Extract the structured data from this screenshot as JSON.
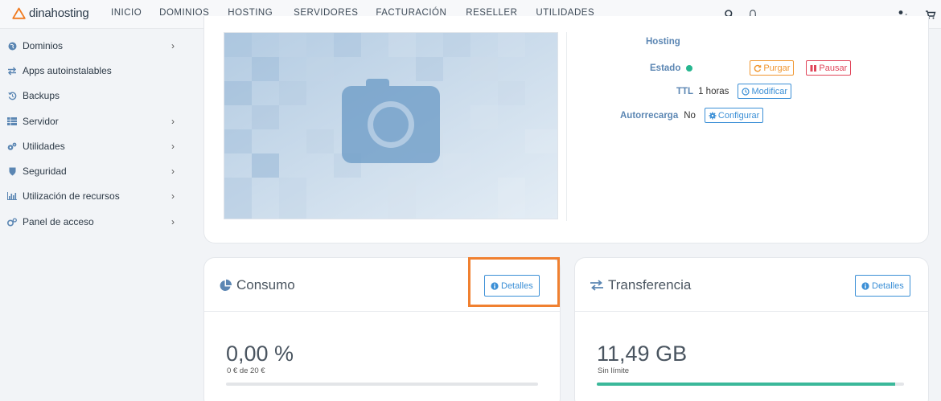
{
  "header": {
    "logo_text": "dinahosting",
    "nav": [
      "INICIO",
      "DOMINIOS",
      "HOSTING",
      "SERVIDORES",
      "FACTURACIÓN",
      "RESELLER",
      "UTILIDADES"
    ],
    "icons": [
      "search-icon",
      "bell-icon",
      "user-icon",
      "cart-icon"
    ]
  },
  "sidebar": {
    "items": [
      {
        "label": "Dominios",
        "icon": "globe-icon",
        "chevron": true
      },
      {
        "label": "Apps autoinstalables",
        "icon": "exchange-icon",
        "chevron": false
      },
      {
        "label": "Backups",
        "icon": "history-icon",
        "chevron": false
      },
      {
        "label": "Servidor",
        "icon": "server-icon",
        "chevron": true
      },
      {
        "label": "Utilidades",
        "icon": "cogs-icon",
        "chevron": true
      },
      {
        "label": "Seguridad",
        "icon": "shield-icon",
        "chevron": true
      },
      {
        "label": "Utilización de recursos",
        "icon": "bar-chart-icon",
        "chevron": true
      },
      {
        "label": "Panel de acceso",
        "icon": "gears-icon",
        "chevron": true
      }
    ],
    "chevron_glyph": "›"
  },
  "details": {
    "hosting_label": "Hosting",
    "estado_label": "Estado",
    "purgar_label": "Purgar",
    "pausar_label": "Pausar",
    "ttl_label": "TTL",
    "ttl_value": "1 horas",
    "modificar_label": "Modificar",
    "autorrecarga_label": "Autorrecarga",
    "autorrecarga_value": "No",
    "configurar_label": "Configurar",
    "status_color": "#26b68f"
  },
  "consumo": {
    "title": "Consumo",
    "detalles_label": "Detalles",
    "value": "0,00 %",
    "sub": "0 € de 20 €",
    "progress": 0
  },
  "transferencia": {
    "title": "Transferencia",
    "detalles_label": "Detalles",
    "value": "11,49 GB",
    "sub": "Sin límite",
    "progress": 0.97
  },
  "colors": {
    "accent_blue": "#3b8fd6",
    "highlight_orange": "#f08030",
    "progress_green": "#3bb89a"
  }
}
